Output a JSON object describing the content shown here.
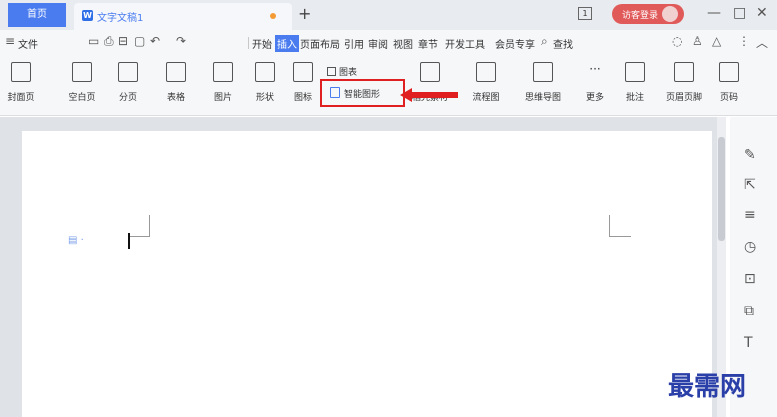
{
  "titlebar": {
    "home_tab": "首页",
    "doc_tab_icon_letter": "W",
    "doc_tab_title": "文字文稿1",
    "new_tab": "+",
    "tab_count": "1",
    "login_button": "访客登录",
    "minimize": "—",
    "maximize": "□",
    "close": "✕"
  },
  "menubar": {
    "hamburger": "≡",
    "file": "文件",
    "items": [
      "开始",
      "插入",
      "页面布局",
      "引用",
      "审阅",
      "视图",
      "章节",
      "开发工具",
      "会员专享"
    ],
    "active_item": "插入",
    "search": "查找"
  },
  "ribbon": {
    "buttons": [
      "封面页",
      "空白页",
      "分页",
      "表格",
      "图片",
      "形状",
      "图标",
      "图表",
      "智能图形",
      "稻壳素材",
      "流程图",
      "思维导图",
      "更多",
      "批注",
      "页眉页脚",
      "页码"
    ]
  },
  "sidebar": {
    "icons": [
      "pen-icon",
      "cursor-icon",
      "sliders-icon",
      "clock-icon",
      "doc-search-icon",
      "doc-copy-icon",
      "text-icon"
    ]
  },
  "watermark": "最需网",
  "colors": {
    "accent": "#4a7cf0",
    "highlight_red": "#e02020",
    "watermark": "#2a3fa8"
  }
}
